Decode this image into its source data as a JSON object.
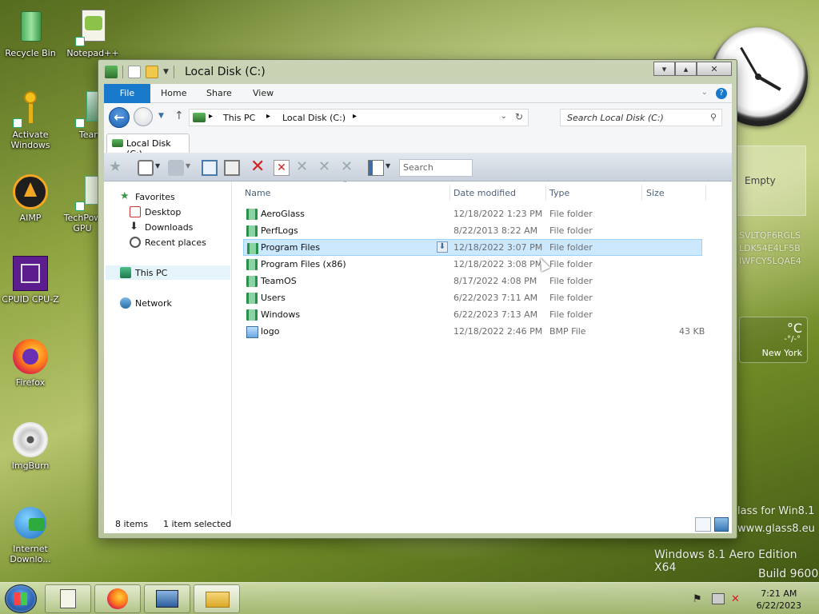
{
  "desktop": {
    "icons": [
      {
        "label": "Recycle Bin"
      },
      {
        "label": "Notepad++"
      },
      {
        "label": "Activate Windows"
      },
      {
        "label": "Team"
      },
      {
        "label": "AIMP"
      },
      {
        "label": "TechPow GPU"
      },
      {
        "label": "CPUID CPU-Z"
      },
      {
        "label": "Firefox"
      },
      {
        "label": "ImgBurn"
      },
      {
        "label": "Internet Downlo..."
      }
    ],
    "wallpaper_text": {
      "brand": "lass for Win8.1",
      "url": "www.glass8.eu",
      "edition": "Windows 8.1 Aero Edition X64",
      "build": "Build 9600"
    }
  },
  "gadgets": {
    "panel_label": "Empty",
    "keys": [
      "SVLTQF6RGLS",
      "LDK54E4LF5B",
      "IWFCY5LQAE4"
    ],
    "weather_unit": "°C",
    "weather_dash": "-°/-°",
    "weather_city": "New York"
  },
  "window": {
    "title": "Local Disk (C:)",
    "ribbon_tabs": [
      "File",
      "Home",
      "Share",
      "View"
    ],
    "address": {
      "crumbs": [
        "This PC",
        "Local Disk (C:)"
      ],
      "search_placeholder": "Search Local Disk (C:)"
    },
    "folder_tab": "Local Disk (C:)",
    "toolbar_search_placeholder": "Search",
    "nav_pane": {
      "favorites": "Favorites",
      "favorites_items": [
        "Desktop",
        "Downloads",
        "Recent places"
      ],
      "this_pc": "This PC",
      "network": "Network"
    },
    "columns": [
      "Name",
      "Date modified",
      "Type",
      "Size"
    ],
    "files": [
      {
        "name": "AeroGlass",
        "date": "12/18/2022 1:23 PM",
        "type": "File folder",
        "size": ""
      },
      {
        "name": "PerfLogs",
        "date": "8/22/2013 8:22 AM",
        "type": "File folder",
        "size": ""
      },
      {
        "name": "Program Files",
        "date": "12/18/2022 3:07 PM",
        "type": "File folder",
        "size": ""
      },
      {
        "name": "Program Files (x86)",
        "date": "12/18/2022 3:08 PM",
        "type": "File folder",
        "size": ""
      },
      {
        "name": "TeamOS",
        "date": "8/17/2022 4:08 PM",
        "type": "File folder",
        "size": ""
      },
      {
        "name": "Users",
        "date": "6/22/2023 7:11 AM",
        "type": "File folder",
        "size": ""
      },
      {
        "name": "Windows",
        "date": "6/22/2023 7:13 AM",
        "type": "File folder",
        "size": ""
      },
      {
        "name": "logo",
        "date": "12/18/2022 2:46 PM",
        "type": "BMP File",
        "size": "43 KB"
      }
    ],
    "status": {
      "count": "8 items",
      "selected": "1 item selected"
    }
  },
  "taskbar": {
    "time": "7:21 AM",
    "date": "6/22/2023"
  },
  "colors": {
    "accent": "#1979ca",
    "selection": "#cce8ff"
  }
}
